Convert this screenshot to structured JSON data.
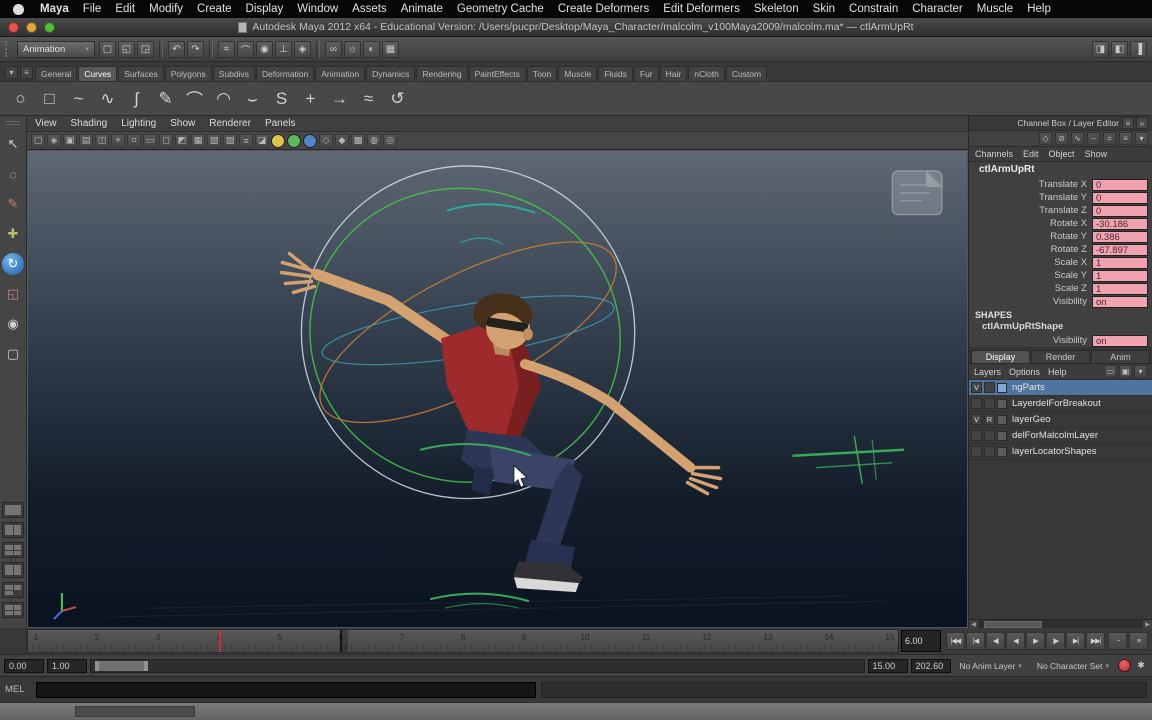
{
  "colors": {
    "viewport_top": "#5e6874",
    "viewport_mid": "#333f4e",
    "viewport_low": "#141e2b",
    "viewport_bottom": "#0a1220",
    "shirt": "#9e2b2b",
    "shirt_shadow": "#7a1f1f",
    "pants": "#2d3654",
    "pants_light": "#3a4468",
    "skin": "#d4a171",
    "hair": "#46301c",
    "manip_outer": "#d6e1ea",
    "manip_green": "#46c24a",
    "manip_orange": "#cd7f34",
    "manip_cyan": "#3fb0c4",
    "curve_green": "#3aa85a",
    "curve_teal": "#2fa8a0",
    "channel_value_bg": "#f0a2b0",
    "selection_blue": "#4f759e",
    "autokey_red": "#b52f2f"
  },
  "macbar": {
    "menus": [
      "Maya",
      "File",
      "Edit",
      "Modify",
      "Create",
      "Display",
      "Window",
      "Assets",
      "Animate",
      "Geometry Cache",
      "Create Deformers",
      "Edit Deformers",
      "Skeleton",
      "Skin",
      "Constrain",
      "Character",
      "Muscle",
      "Help"
    ]
  },
  "titlebar": {
    "title": "Autodesk Maya 2012 x64 - Educational Version: /Users/pucpr/Desktop/Maya_Character/malcolm_v100Maya2009/malcolm.ma* — ctlArmUpRt"
  },
  "statusline": {
    "menuset": "Animation",
    "groups": [
      {
        "icons": [
          {
            "name": "new-scene-icon",
            "glyph": "▢"
          },
          {
            "name": "open-scene-icon",
            "glyph": "◱"
          },
          {
            "name": "save-scene-icon",
            "glyph": "◲"
          }
        ]
      },
      {
        "icons": [
          {
            "name": "undo-icon",
            "glyph": "↶"
          },
          {
            "name": "redo-icon",
            "glyph": "↷"
          }
        ]
      },
      {
        "icons": [
          {
            "name": "snap-grid-icon",
            "glyph": "⌗"
          },
          {
            "name": "snap-curve-icon",
            "glyph": "⌒"
          },
          {
            "name": "snap-point-icon",
            "glyph": "◉"
          },
          {
            "name": "snap-plane-icon",
            "glyph": "⊥"
          },
          {
            "name": "make-live-icon",
            "glyph": "◈"
          }
        ]
      },
      {
        "icons": [
          {
            "name": "construction-history-icon",
            "glyph": "∞"
          },
          {
            "name": "render-icon",
            "glyph": "☼"
          },
          {
            "name": "ipr-render-icon",
            "glyph": "◐"
          },
          {
            "name": "render-settings-icon",
            "glyph": "▦"
          }
        ]
      }
    ],
    "right_icons": [
      {
        "name": "attribute-editor-toggle",
        "glyph": "◨"
      },
      {
        "name": "tool-settings-toggle",
        "glyph": "◧"
      },
      {
        "name": "channel-box-toggle",
        "glyph": "▐"
      }
    ]
  },
  "shelf": {
    "left_icons": [
      {
        "name": "shelf-tab-menu-icon",
        "glyph": "▾"
      },
      {
        "name": "shelf-editor-icon",
        "glyph": "≡"
      }
    ],
    "tabs": [
      "General",
      "Curves",
      "Surfaces",
      "Polygons",
      "Subdivs",
      "Deformation",
      "Animation",
      "Dynamics",
      "Rendering",
      "PaintEffects",
      "Toon",
      "Muscle",
      "Fluids",
      "Fur",
      "Hair",
      "nCloth",
      "Custom"
    ],
    "selected_tab": "Curves",
    "icons": [
      {
        "name": "nurbs-circle-tool",
        "glyph": "○"
      },
      {
        "name": "nurbs-square-tool",
        "glyph": "□"
      },
      {
        "name": "cv-curve-tool",
        "glyph": "~"
      },
      {
        "name": "ep-curve-tool",
        "glyph": "∿"
      },
      {
        "name": "bezier-curve-tool",
        "glyph": "ʃ"
      },
      {
        "name": "pencil-curve-tool",
        "glyph": "✎"
      },
      {
        "name": "two-point-arc-tool",
        "glyph": "⌒"
      },
      {
        "name": "three-point-arc-tool",
        "glyph": "◠"
      },
      {
        "name": "attach-curves-tool",
        "glyph": "⌣"
      },
      {
        "name": "detach-curves-tool",
        "glyph": "S"
      },
      {
        "name": "insert-knot-tool",
        "glyph": "+"
      },
      {
        "name": "extend-curve-tool",
        "glyph": "→"
      },
      {
        "name": "rebuild-curve-tool",
        "glyph": "≈"
      },
      {
        "name": "reverse-curve-tool",
        "glyph": "↺"
      }
    ]
  },
  "toolbox": {
    "tools": [
      {
        "name": "select-tool-button",
        "glyph": "↖"
      },
      {
        "name": "lasso-tool-button",
        "glyph": "◌"
      },
      {
        "name": "paint-select-tool-button",
        "glyph": "✎",
        "color": "#c87f6d"
      },
      {
        "name": "move-tool-button",
        "glyph": "✚",
        "color": "#bdbd72"
      },
      {
        "name": "rotate-tool-button",
        "glyph": "↻",
        "active": true
      },
      {
        "name": "scale-tool-button",
        "glyph": "◱",
        "color": "#bd8484"
      },
      {
        "name": "universal-manip-tool-button",
        "glyph": "◉"
      },
      {
        "name": "last-tool-button",
        "glyph": "▢"
      }
    ],
    "layouts": [
      {
        "name": "single-pane-layout-button",
        "panes": 1
      },
      {
        "name": "two-pane-side-layout-button",
        "panes": 2
      },
      {
        "name": "four-pane-layout-button",
        "panes": 4
      },
      {
        "name": "persp-outliner-layout-button",
        "panes": 2
      },
      {
        "name": "three-pane-layout-button",
        "panes": 3
      },
      {
        "name": "hypergraph-persp-layout-button",
        "panes": 4
      }
    ]
  },
  "viewport": {
    "menu": [
      "View",
      "Shading",
      "Lighting",
      "Show",
      "Renderer",
      "Panels"
    ],
    "toolbar_icons": [
      {
        "name": "select-camera-icon",
        "glyph": "▢"
      },
      {
        "name": "lock-camera-icon",
        "glyph": "◈"
      },
      {
        "name": "camera-attributes-icon",
        "glyph": "▣"
      },
      {
        "name": "bookmarks-icon",
        "glyph": "▤"
      },
      {
        "name": "image-plane-icon",
        "glyph": "◫"
      },
      {
        "name": "pan-zoom-icon",
        "glyph": "⌖"
      },
      {
        "name": "grid-icon",
        "glyph": "⌗"
      },
      {
        "name": "film-gate-icon",
        "glyph": "▭"
      },
      {
        "name": "resolution-gate-icon",
        "glyph": "◻"
      },
      {
        "name": "gate-mask-icon",
        "glyph": "◩"
      },
      {
        "name": "field-chart-icon",
        "glyph": "▦"
      },
      {
        "name": "safe-action-icon",
        "glyph": "▧"
      },
      {
        "name": "safe-title-icon",
        "glyph": "▨"
      },
      {
        "name": "hud-icon",
        "glyph": "≡"
      },
      {
        "name": "object-details-icon",
        "glyph": "◪"
      },
      {
        "name": "lighting-all-icon",
        "glyph": "",
        "color": "#ddc44a"
      },
      {
        "name": "shadows-icon",
        "glyph": "",
        "color": "#5bb85b"
      },
      {
        "name": "ambient-occlusion-icon",
        "glyph": "",
        "color": "#4f86c8"
      },
      {
        "name": "wireframe-icon",
        "glyph": "◇"
      },
      {
        "name": "shaded-icon",
        "glyph": "◆"
      },
      {
        "name": "textured-icon",
        "glyph": "▩"
      },
      {
        "name": "xray-icon",
        "glyph": "◍"
      },
      {
        "name": "isolate-select-icon",
        "glyph": "◎"
      }
    ]
  },
  "channelbox": {
    "header": "Channel Box / Layer Editor",
    "header_icons": [
      {
        "name": "panel-menu-icon",
        "glyph": "≡"
      },
      {
        "name": "collapse-panel-icon",
        "glyph": "»"
      }
    ],
    "icon_row": [
      {
        "name": "channel-manip-icon",
        "glyph": "◇"
      },
      {
        "name": "channel-no-manip-icon",
        "glyph": "⊘"
      },
      {
        "name": "channel-hyperbolic-icon",
        "glyph": "∿"
      },
      {
        "name": "channel-slow-speed-icon",
        "glyph": "–"
      },
      {
        "name": "channel-medium-speed-icon",
        "glyph": "="
      },
      {
        "name": "channel-fast-speed-icon",
        "glyph": "≡"
      },
      {
        "name": "channel-menu-icon",
        "glyph": "▾"
      }
    ],
    "menu": [
      "Channels",
      "Edit",
      "Object",
      "Show"
    ],
    "object_name": "ctlArmUpRt",
    "channels": [
      {
        "name": "Translate X",
        "value": "0"
      },
      {
        "name": "Translate Y",
        "value": "0"
      },
      {
        "name": "Translate Z",
        "value": "0"
      },
      {
        "name": "Rotate X",
        "value": "-30.186"
      },
      {
        "name": "Rotate Y",
        "value": "0.386"
      },
      {
        "name": "Rotate Z",
        "value": "-67.897"
      },
      {
        "name": "Scale X",
        "value": "1"
      },
      {
        "name": "Scale Y",
        "value": "1"
      },
      {
        "name": "Scale Z",
        "value": "1"
      },
      {
        "name": "Visibility",
        "value": "on"
      }
    ],
    "shapes_label": "SHAPES",
    "shape_node": "ctlArmUpRtShape",
    "shape_channels": [
      {
        "name": "Visibility",
        "value": "on"
      }
    ]
  },
  "layereditor": {
    "tabs": [
      "Display",
      "Render",
      "Anim"
    ],
    "selected_tab": "Display",
    "menu": [
      "Layers",
      "Options",
      "Help"
    ],
    "menu_icons": [
      {
        "name": "new-empty-layer-button",
        "glyph": "▭"
      },
      {
        "name": "new-layer-assign-selected-button",
        "glyph": "▣"
      },
      {
        "name": "layer-sort-icon",
        "glyph": "▾"
      }
    ],
    "layers": [
      {
        "name": "ngParts",
        "v": "V",
        "type": "",
        "swatch": "#7ea7d8",
        "selected": true
      },
      {
        "name": "LayerdelForBreakout",
        "v": "",
        "type": "",
        "swatch": ""
      },
      {
        "name": "layerGeo",
        "v": "V",
        "type": "R",
        "swatch": ""
      },
      {
        "name": "delForMalcolmLayer",
        "v": "",
        "type": "",
        "swatch": ""
      },
      {
        "name": "layerLocatorShapes",
        "v": "",
        "type": "",
        "swatch": ""
      }
    ]
  },
  "timeline": {
    "tick_labels": [
      "1",
      "2",
      "3",
      "4",
      "5",
      "6",
      "7",
      "8",
      "9",
      "10",
      "11",
      "12",
      "13",
      "14",
      "15"
    ],
    "current_time": "6.00",
    "key_frames": [
      "4"
    ],
    "transport": [
      {
        "name": "go-to-start-button",
        "glyph": "|◀◀"
      },
      {
        "name": "step-back-frame-button",
        "glyph": "|◀"
      },
      {
        "name": "step-back-key-button",
        "glyph": "◀|"
      },
      {
        "name": "play-backwards-button",
        "glyph": "◀"
      },
      {
        "name": "play-forward-button",
        "glyph": "▶"
      },
      {
        "name": "step-forward-key-button",
        "glyph": "|▶"
      },
      {
        "name": "step-forward-frame-button",
        "glyph": "▶|"
      },
      {
        "name": "go-to-end-button",
        "glyph": "▶▶|"
      }
    ],
    "extra_buttons": [
      {
        "name": "playback-options-button",
        "glyph": "◔"
      },
      {
        "name": "anim-menu-button",
        "glyph": "≡"
      }
    ]
  },
  "rangeslider": {
    "anim_start": "0.00",
    "play_start": "1.00",
    "play_end": "15.00",
    "anim_end": "202.60",
    "anim_layer_button": "No Anim Layer",
    "character_set_button": "No Character Set"
  },
  "mel": {
    "label": "MEL"
  }
}
